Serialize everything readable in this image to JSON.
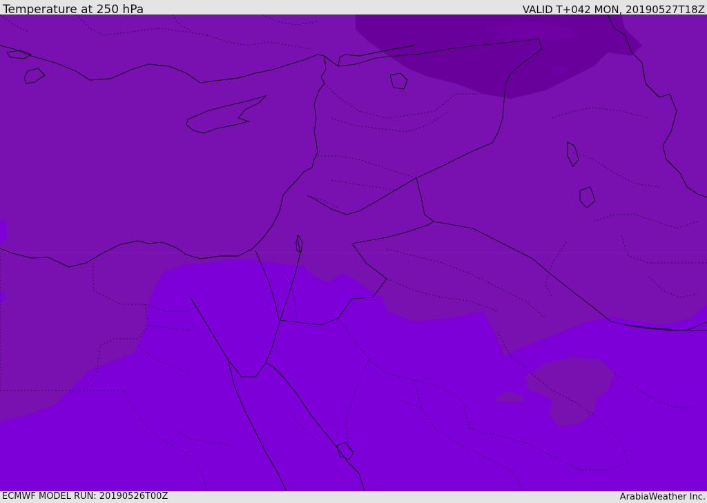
{
  "header": {
    "title": "Temperature at 250 hPa",
    "valid_time": "VALID T+042 MON, 20190527T18Z"
  },
  "footer": {
    "model_run": "ECMWF MODEL RUN: 20190526T00Z",
    "credit": "ArabiaWeather Inc."
  },
  "map": {
    "field": "temperature",
    "level_hpa": 250,
    "colors": {
      "mid_band": "#7911b0",
      "warm_band": "#7d00d8",
      "cold_band": "#6a009c",
      "coastline": "#000000",
      "borders": "#1a0030"
    }
  }
}
